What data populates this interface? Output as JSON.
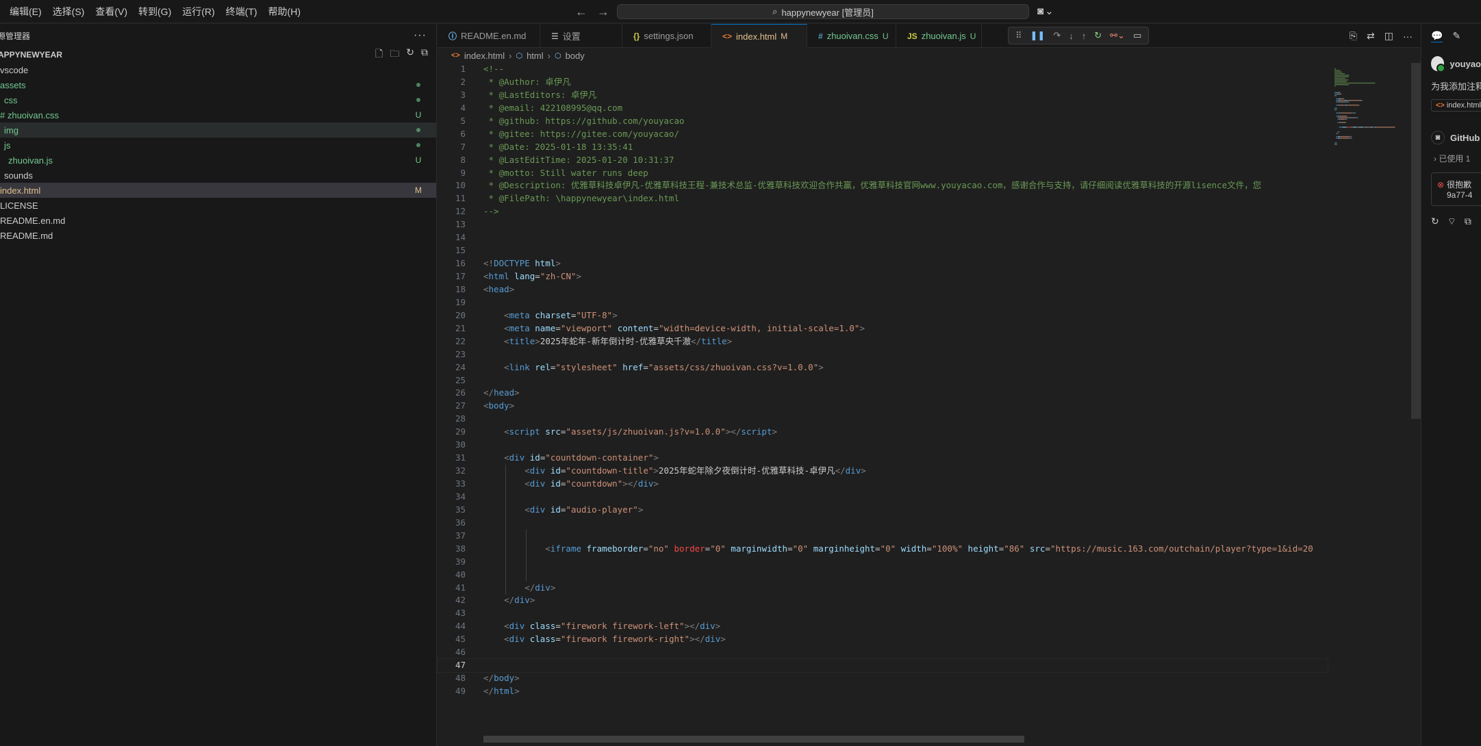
{
  "menubar": [
    "编辑(E)",
    "选择(S)",
    "查看(V)",
    "转到(G)",
    "运行(R)",
    "终端(T)",
    "帮助(H)"
  ],
  "command_center": "happynewyear [管理员]",
  "sidebar": {
    "title": "源管理器",
    "folder": "APPYNEWYEAR",
    "tree": [
      {
        "label": "vscode",
        "indent": 0,
        "color": "def",
        "badge": ""
      },
      {
        "label": "assets",
        "indent": 0,
        "color": "green",
        "badge": "dot"
      },
      {
        "label": "css",
        "indent": 6,
        "color": "green",
        "badge": "dot"
      },
      {
        "label": "# zhuoivan.css",
        "indent": 0,
        "color": "green",
        "badge": "U"
      },
      {
        "label": "img",
        "indent": 6,
        "color": "green",
        "badge": "dot",
        "state": "sel-light"
      },
      {
        "label": "js",
        "indent": 6,
        "color": "green",
        "badge": "dot"
      },
      {
        "label": "zhuoivan.js",
        "indent": 12,
        "color": "green",
        "badge": "U"
      },
      {
        "label": "sounds",
        "indent": 6,
        "color": "def",
        "badge": ""
      },
      {
        "label": "index.html",
        "indent": 0,
        "color": "mod",
        "badge": "M",
        "state": "sel"
      },
      {
        "label": "LICENSE",
        "indent": 0,
        "color": "def",
        "badge": ""
      },
      {
        "label": "README.en.md",
        "indent": 0,
        "color": "def",
        "badge": ""
      },
      {
        "label": "README.md",
        "indent": 0,
        "color": "def",
        "badge": ""
      }
    ]
  },
  "tabs": [
    {
      "label": "README.en.md",
      "icon": "info-icon",
      "status": "",
      "active": false
    },
    {
      "label": "设置",
      "icon": "settings-icon",
      "status": "",
      "active": false
    },
    {
      "label": "settings.json",
      "icon": "json-icon",
      "status": "",
      "active": false
    },
    {
      "label": "index.html",
      "icon": "html-icon",
      "status": "M",
      "active": true
    },
    {
      "label": "zhuoivan.css",
      "icon": "css-icon",
      "status": "U",
      "active": false
    },
    {
      "label": "zhuoivan.js",
      "icon": "js-icon",
      "status": "U",
      "active": false
    }
  ],
  "breadcrumb": [
    "index.html",
    "html",
    "body"
  ],
  "current_line": 47,
  "code_lines": [
    [
      [
        "com",
        "<!--"
      ]
    ],
    [
      [
        "com",
        " * @Author: 卓伊凡"
      ]
    ],
    [
      [
        "com",
        " * @LastEditors: 卓伊凡"
      ]
    ],
    [
      [
        "com",
        " * @email: 422108995@qq.com"
      ]
    ],
    [
      [
        "com",
        " * @github: https://github.com/youyacao"
      ]
    ],
    [
      [
        "com",
        " * @gitee: https://gitee.com/youyacao/"
      ]
    ],
    [
      [
        "com",
        " * @Date: 2025-01-18 13:35:41"
      ]
    ],
    [
      [
        "com",
        " * @LastEditTime: 2025-01-20 10:31:37"
      ]
    ],
    [
      [
        "com",
        " * @motto: Still water runs deep"
      ]
    ],
    [
      [
        "com",
        " * @Description: 优雅草科技卓伊凡-优雅草科技王程-兼技术总监-优雅草科技欢迎合作共赢，优雅草科技官网www.youyacao.com，感谢合作与支持，请仔细阅读优雅草科技的开源lisence文件，您"
      ]
    ],
    [
      [
        "com",
        " * @FilePath: \\happynewyear\\index.html"
      ]
    ],
    [
      [
        "com",
        "-->"
      ]
    ],
    [],
    [],
    [],
    [
      [
        "brk",
        "<!"
      ],
      [
        "doc",
        "DOCTYPE"
      ],
      [
        "txt",
        " "
      ],
      [
        "attr",
        "html"
      ],
      [
        "brk",
        ">"
      ]
    ],
    [
      [
        "brk",
        "<"
      ],
      [
        "tag",
        "html"
      ],
      [
        "txt",
        " "
      ],
      [
        "attr",
        "lang"
      ],
      [
        "txt",
        "="
      ],
      [
        "str",
        "\"zh-CN\""
      ],
      [
        "brk",
        ">"
      ]
    ],
    [
      [
        "brk",
        "<"
      ],
      [
        "tag",
        "head"
      ],
      [
        "brk",
        ">"
      ]
    ],
    [],
    [
      [
        "txt",
        "    "
      ],
      [
        "brk",
        "<"
      ],
      [
        "tag",
        "meta"
      ],
      [
        "txt",
        " "
      ],
      [
        "attr",
        "charset"
      ],
      [
        "txt",
        "="
      ],
      [
        "str",
        "\"UTF-8\""
      ],
      [
        "brk",
        ">"
      ]
    ],
    [
      [
        "txt",
        "    "
      ],
      [
        "brk",
        "<"
      ],
      [
        "tag",
        "meta"
      ],
      [
        "txt",
        " "
      ],
      [
        "attr",
        "name"
      ],
      [
        "txt",
        "="
      ],
      [
        "str",
        "\"viewport\""
      ],
      [
        "txt",
        " "
      ],
      [
        "attr",
        "content"
      ],
      [
        "txt",
        "="
      ],
      [
        "str",
        "\"width=device-width, initial-scale=1.0\""
      ],
      [
        "brk",
        ">"
      ]
    ],
    [
      [
        "txt",
        "    "
      ],
      [
        "brk",
        "<"
      ],
      [
        "tag",
        "title"
      ],
      [
        "brk",
        ">"
      ],
      [
        "txt",
        "2025年蛇年-新年倒计时-优雅草央千澈"
      ],
      [
        "brk",
        "</"
      ],
      [
        "tag",
        "title"
      ],
      [
        "brk",
        ">"
      ]
    ],
    [],
    [
      [
        "txt",
        "    "
      ],
      [
        "brk",
        "<"
      ],
      [
        "tag",
        "link"
      ],
      [
        "txt",
        " "
      ],
      [
        "attr",
        "rel"
      ],
      [
        "txt",
        "="
      ],
      [
        "str",
        "\"stylesheet\""
      ],
      [
        "txt",
        " "
      ],
      [
        "attr",
        "href"
      ],
      [
        "txt",
        "="
      ],
      [
        "str",
        "\"assets/css/zhuoivan.css?v=1.0.0\""
      ],
      [
        "brk",
        ">"
      ]
    ],
    [],
    [
      [
        "brk",
        "</"
      ],
      [
        "tag",
        "head"
      ],
      [
        "brk",
        ">"
      ]
    ],
    [
      [
        "brk",
        "<"
      ],
      [
        "tag",
        "body"
      ],
      [
        "brk",
        ">"
      ]
    ],
    [],
    [
      [
        "txt",
        "    "
      ],
      [
        "brk",
        "<"
      ],
      [
        "tag",
        "script"
      ],
      [
        "txt",
        " "
      ],
      [
        "attr",
        "src"
      ],
      [
        "txt",
        "="
      ],
      [
        "str",
        "\"assets/js/zhuoivan.js?v=1.0.0\""
      ],
      [
        "brk",
        "></"
      ],
      [
        "tag",
        "script"
      ],
      [
        "brk",
        ">"
      ]
    ],
    [],
    [
      [
        "txt",
        "    "
      ],
      [
        "brk",
        "<"
      ],
      [
        "tag",
        "div"
      ],
      [
        "txt",
        " "
      ],
      [
        "attr",
        "id"
      ],
      [
        "txt",
        "="
      ],
      [
        "str",
        "\"countdown-container\""
      ],
      [
        "brk",
        ">"
      ]
    ],
    [
      [
        "txt",
        "        "
      ],
      [
        "brk",
        "<"
      ],
      [
        "tag",
        "div"
      ],
      [
        "txt",
        " "
      ],
      [
        "attr",
        "id"
      ],
      [
        "txt",
        "="
      ],
      [
        "str",
        "\"countdown-title\""
      ],
      [
        "brk",
        ">"
      ],
      [
        "txt",
        "2025年蛇年除夕夜倒计时-优雅草科技-卓伊凡"
      ],
      [
        "brk",
        "</"
      ],
      [
        "tag",
        "div"
      ],
      [
        "brk",
        ">"
      ]
    ],
    [
      [
        "txt",
        "        "
      ],
      [
        "brk",
        "<"
      ],
      [
        "tag",
        "div"
      ],
      [
        "txt",
        " "
      ],
      [
        "attr",
        "id"
      ],
      [
        "txt",
        "="
      ],
      [
        "str",
        "\"countdown\""
      ],
      [
        "brk",
        "></"
      ],
      [
        "tag",
        "div"
      ],
      [
        "brk",
        ">"
      ]
    ],
    [],
    [
      [
        "txt",
        "        "
      ],
      [
        "brk",
        "<"
      ],
      [
        "tag",
        "div"
      ],
      [
        "txt",
        " "
      ],
      [
        "attr",
        "id"
      ],
      [
        "txt",
        "="
      ],
      [
        "str",
        "\"audio-player\""
      ],
      [
        "brk",
        ">"
      ]
    ],
    [],
    [],
    [
      [
        "txt",
        "            "
      ],
      [
        "brk",
        "<"
      ],
      [
        "tag",
        "iframe"
      ],
      [
        "txt",
        " "
      ],
      [
        "attr",
        "frameborder"
      ],
      [
        "txt",
        "="
      ],
      [
        "str",
        "\"no\""
      ],
      [
        "txt",
        " "
      ],
      [
        "red",
        "border"
      ],
      [
        "txt",
        "="
      ],
      [
        "str",
        "\"0\""
      ],
      [
        "txt",
        " "
      ],
      [
        "attr",
        "marginwidth"
      ],
      [
        "txt",
        "="
      ],
      [
        "str",
        "\"0\""
      ],
      [
        "txt",
        " "
      ],
      [
        "attr",
        "marginheight"
      ],
      [
        "txt",
        "="
      ],
      [
        "str",
        "\"0\""
      ],
      [
        "txt",
        " "
      ],
      [
        "attr",
        "width"
      ],
      [
        "txt",
        "="
      ],
      [
        "str",
        "\"100%\""
      ],
      [
        "txt",
        " "
      ],
      [
        "attr",
        "height"
      ],
      [
        "txt",
        "="
      ],
      [
        "str",
        "\"86\""
      ],
      [
        "txt",
        " "
      ],
      [
        "attr",
        "src"
      ],
      [
        "txt",
        "="
      ],
      [
        "str",
        "\"https://music.163.com/outchain/player?type=1&id=20"
      ]
    ],
    [],
    [],
    [
      [
        "txt",
        "        "
      ],
      [
        "brk",
        "</"
      ],
      [
        "tag",
        "div"
      ],
      [
        "brk",
        ">"
      ]
    ],
    [
      [
        "txt",
        "    "
      ],
      [
        "brk",
        "</"
      ],
      [
        "tag",
        "div"
      ],
      [
        "brk",
        ">"
      ]
    ],
    [],
    [
      [
        "txt",
        "    "
      ],
      [
        "brk",
        "<"
      ],
      [
        "tag",
        "div"
      ],
      [
        "txt",
        " "
      ],
      [
        "attr",
        "class"
      ],
      [
        "txt",
        "="
      ],
      [
        "str",
        "\"firework firework-left\""
      ],
      [
        "brk",
        "></"
      ],
      [
        "tag",
        "div"
      ],
      [
        "brk",
        ">"
      ]
    ],
    [
      [
        "txt",
        "    "
      ],
      [
        "brk",
        "<"
      ],
      [
        "tag",
        "div"
      ],
      [
        "txt",
        " "
      ],
      [
        "attr",
        "class"
      ],
      [
        "txt",
        "="
      ],
      [
        "str",
        "\"firework firework-right\""
      ],
      [
        "brk",
        "></"
      ],
      [
        "tag",
        "div"
      ],
      [
        "brk",
        ">"
      ]
    ],
    [],
    [],
    [
      [
        "brk",
        "</"
      ],
      [
        "tag",
        "body"
      ],
      [
        "brk",
        ">"
      ]
    ],
    [
      [
        "brk",
        "</"
      ],
      [
        "tag",
        "html"
      ],
      [
        "brk",
        ">"
      ]
    ]
  ],
  "chat": {
    "user": "youyao",
    "message": "为我添加注释",
    "attachment": "index.html",
    "assistant": "GitHub",
    "used_refs": "已使用 1",
    "error_line1": "很抱歉",
    "error_line2": "9a77-4"
  }
}
